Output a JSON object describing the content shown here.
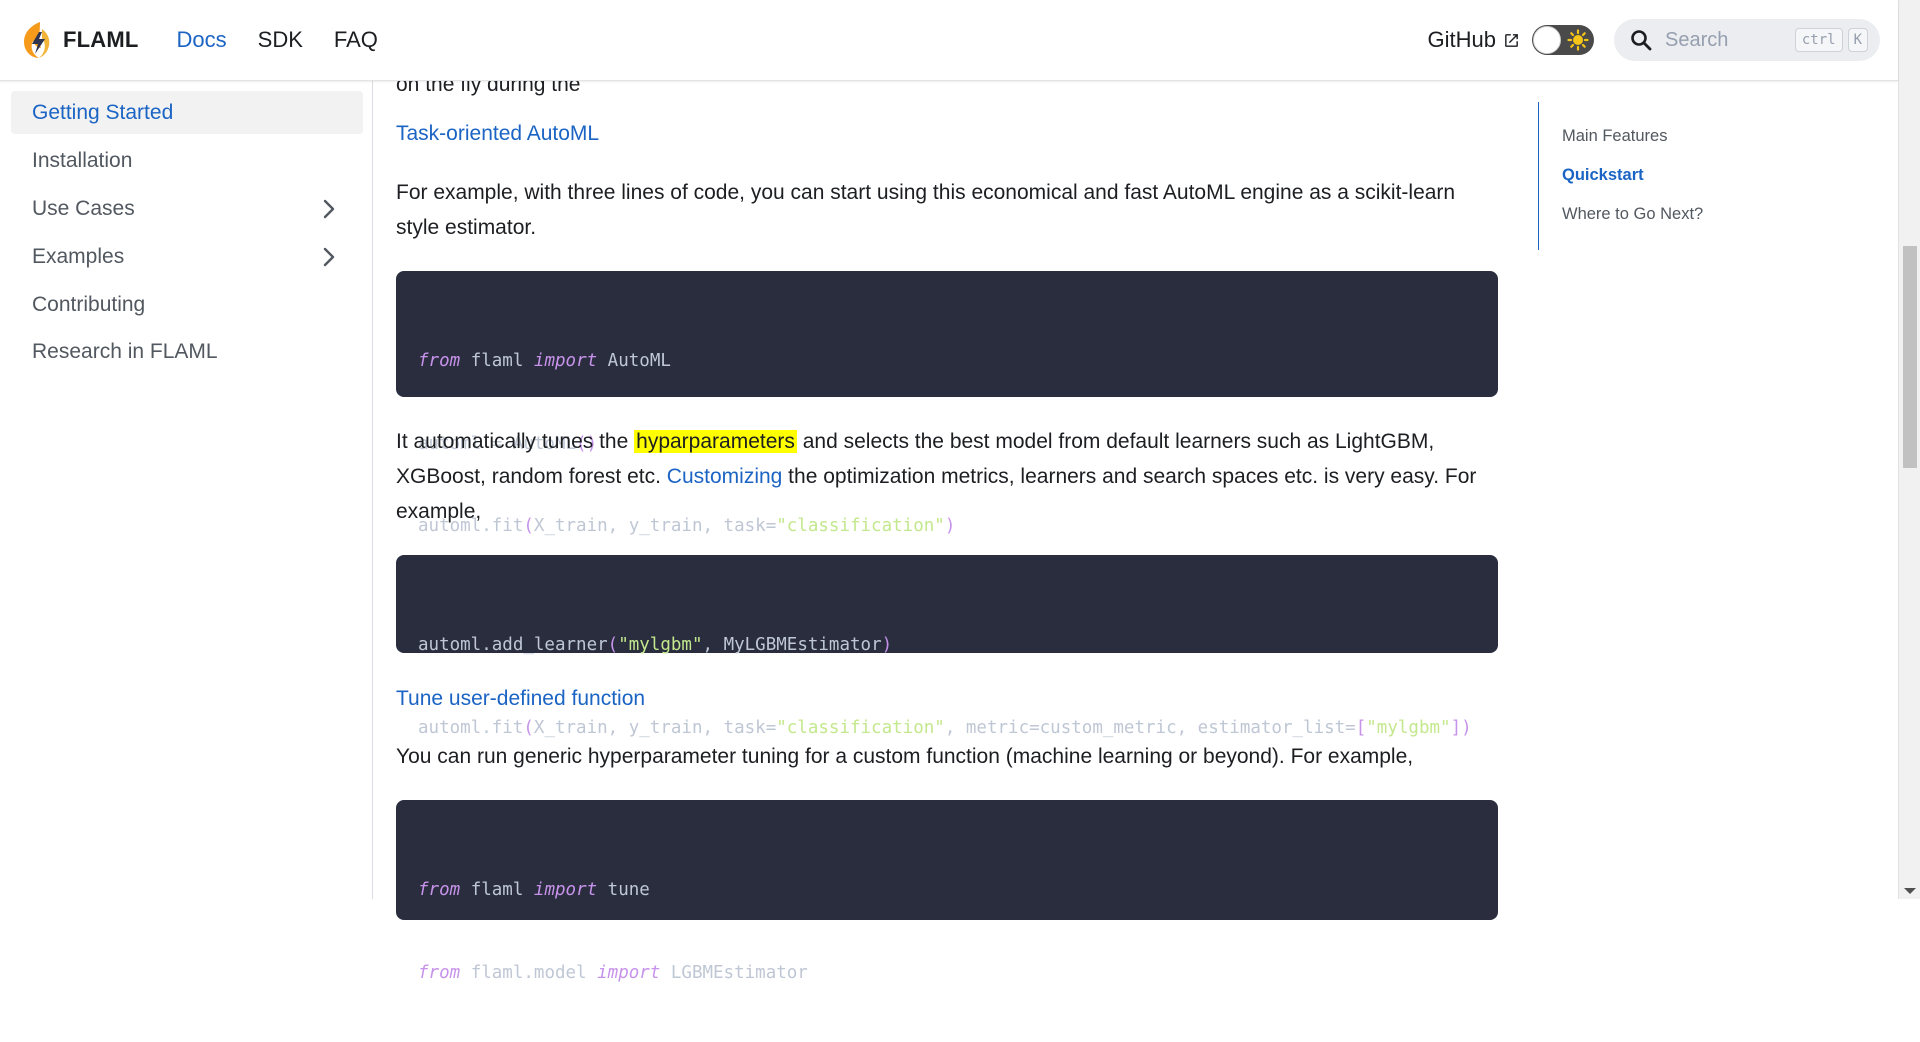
{
  "navbar": {
    "brand": "FLAML",
    "links": [
      "Docs",
      "SDK",
      "FAQ"
    ],
    "github": "GitHub",
    "search_placeholder": "Search",
    "kbd_ctrl": "ctrl",
    "kbd_k": "K"
  },
  "sidebar": {
    "items": [
      {
        "label": "Getting Started",
        "active": true
      },
      {
        "label": "Installation"
      },
      {
        "label": "Use Cases",
        "expandable": true
      },
      {
        "label": "Examples",
        "expandable": true
      },
      {
        "label": "Contributing"
      },
      {
        "label": "Research in FLAML"
      }
    ]
  },
  "main": {
    "cut_line": "on the fly during the",
    "section1_title": "Task-oriented AutoML",
    "para1": "For example, with three lines of code, you can start using this economical and fast AutoML engine as a scikit-learn style estimator.",
    "code1": {
      "l1": {
        "kw1": "from",
        "mod": " flaml ",
        "kw2": "import",
        "name": " AutoML"
      },
      "l2": {
        "a": "automl = AutoML",
        "p": "()"
      },
      "l3": {
        "a": "automl.fit",
        "p1": "(",
        "b": "X_train, y_train, task=",
        "s": "\"classification\"",
        "p2": ")"
      }
    },
    "para2": {
      "t1": "It automatically tunes the ",
      "highlight": "hyparparameters",
      "t2": " and selects the best model from default learners such as LightGBM, XGBoost, random forest etc. ",
      "link": "Customizing",
      "t3": " the optimization metrics, learners and search spaces etc. is very easy. For example,"
    },
    "code2": {
      "l1": {
        "a": "automl.add_learner",
        "p1": "(",
        "s": "\"mylgbm\"",
        "b": ", MyLGBMEstimator",
        "p2": ")"
      },
      "l2": {
        "a": "automl.fit",
        "p1": "(",
        "b": "X_train, y_train, task=",
        "s1": "\"classification\"",
        "c": ", metric=custom_metric, estimator_list=",
        "p3": "[",
        "s2": "\"mylgbm\"",
        "p4": "])"
      }
    },
    "section2_title": "Tune user-defined function",
    "para3": "You can run generic hyperparameter tuning for a custom function (machine learning or beyond). For example,",
    "code3": {
      "l1": {
        "kw1": "from",
        "mod": " flaml ",
        "kw2": "import",
        "name": " tune"
      },
      "l2": {
        "kw1": "from",
        "mod": " flaml.model ",
        "kw2": "import",
        "name": " LGBMEstimator"
      }
    }
  },
  "toc": {
    "items": [
      {
        "label": "Main Features"
      },
      {
        "label": "Quickstart",
        "active": true
      },
      {
        "label": "Where to Go Next?"
      }
    ]
  },
  "colors": {
    "accent": "#1b64c4",
    "code_bg": "#292d3e",
    "highlight": "#ffff00"
  }
}
